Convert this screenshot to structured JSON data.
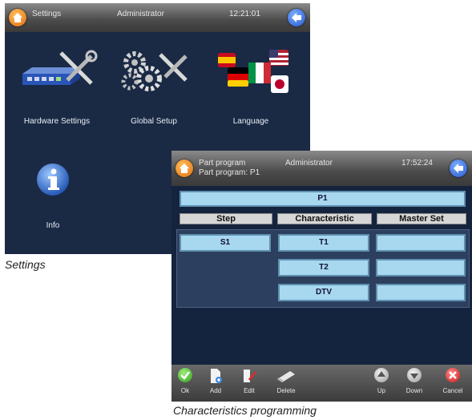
{
  "settings_screen": {
    "topbar": {
      "title": "Settings",
      "user": "Administrator",
      "time": "12:21:01"
    },
    "tiles": [
      {
        "label": "Hardware Settings",
        "icon": "hardware-settings-icon"
      },
      {
        "label": "Global Setup",
        "icon": "global-setup-icon"
      },
      {
        "label": "Language",
        "icon": "language-flags-icon"
      },
      {
        "label": "Info",
        "icon": "info-icon"
      }
    ]
  },
  "settings_caption": "Settings",
  "part_program_screen": {
    "topbar": {
      "title": "Part program",
      "subtitle": "Part program: P1",
      "user": "Administrator",
      "time": "17:52:24"
    },
    "program_name": "P1",
    "columns": [
      "Step",
      "Characteristic",
      "Master Set"
    ],
    "steps": [
      "S1"
    ],
    "characteristics": [
      "T1",
      "T2",
      "DTV"
    ],
    "master_sets": [
      "",
      "",
      ""
    ],
    "buttons": [
      {
        "label": "Ok",
        "icon": "ok-check-icon"
      },
      {
        "label": "Add",
        "icon": "add-document-icon"
      },
      {
        "label": "Edit",
        "icon": "edit-pencil-icon"
      },
      {
        "label": "Delete",
        "icon": "delete-eraser-icon"
      },
      {
        "label": "Up",
        "icon": "up-arrow-icon"
      },
      {
        "label": "Down",
        "icon": "down-arrow-icon"
      },
      {
        "label": "Cancel",
        "icon": "cancel-x-icon"
      }
    ]
  },
  "part_program_caption": "Characteristics programming",
  "colors": {
    "screen_bg": "#1a2a45",
    "field_bg": "#a8d8ef",
    "header_bg": "#d6d6d6",
    "home_orange": "#e06a10",
    "back_blue": "#2255cc"
  }
}
